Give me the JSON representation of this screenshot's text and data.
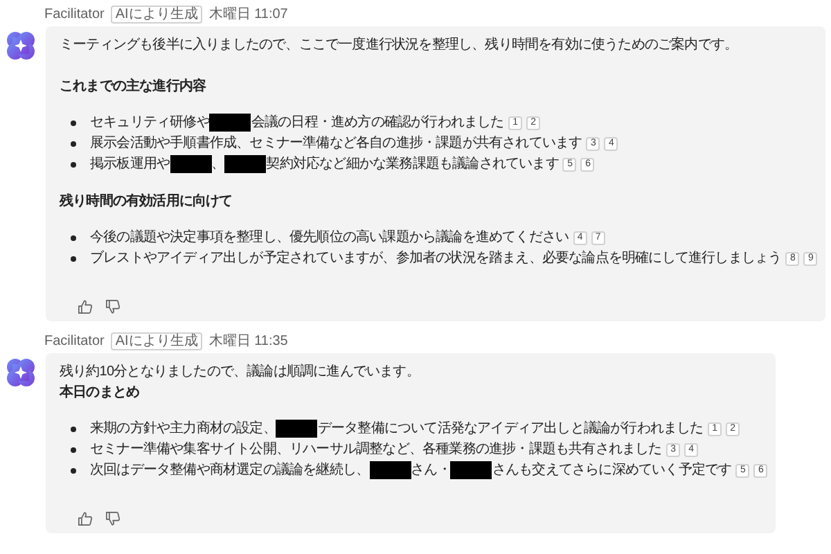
{
  "messages": [
    {
      "sender": "Facilitator",
      "badge": "AIにより生成",
      "time": "木曜日 11:07",
      "blocks": [
        {
          "kind": "paragraph",
          "text": "ミーティングも後半に入りましたので、ここで一度進行状況を整理し、残り時間を有効に使うためのご案内です。"
        },
        {
          "kind": "heading",
          "text": "これまでの主な進行内容"
        },
        {
          "kind": "list",
          "items": [
            {
              "parts": [
                {
                  "kind": "text",
                  "text": "セキュリティ研修や"
                },
                {
                  "kind": "redacted"
                },
                {
                  "kind": "text",
                  "text": "会議の日程・進め方の確認が行われました"
                }
              ],
              "citations": [
                "1",
                "2"
              ]
            },
            {
              "parts": [
                {
                  "kind": "text",
                  "text": "展示会活動や手順書作成、セミナー準備など各自の進捗・課題が共有されています"
                }
              ],
              "citations": [
                "3",
                "4"
              ]
            },
            {
              "parts": [
                {
                  "kind": "text",
                  "text": "掲示板運用や"
                },
                {
                  "kind": "redacted"
                },
                {
                  "kind": "text",
                  "text": "、"
                },
                {
                  "kind": "redacted"
                },
                {
                  "kind": "text",
                  "text": "契約対応など細かな業務課題も議論されています"
                }
              ],
              "citations": [
                "5",
                "6"
              ]
            }
          ]
        },
        {
          "kind": "heading",
          "text": "残り時間の有効活用に向けて"
        },
        {
          "kind": "list",
          "items": [
            {
              "parts": [
                {
                  "kind": "text",
                  "text": "今後の議題や決定事項を整理し、優先順位の高い課題から議論を進めてください"
                }
              ],
              "citations": [
                "4",
                "7"
              ]
            },
            {
              "parts": [
                {
                  "kind": "text",
                  "text": "ブレストやアイディア出しが予定されていますが、参加者の状況を踏まえ、必要な論点を明確にして進行しましょう"
                }
              ],
              "citations": [
                "8",
                "9"
              ]
            }
          ]
        }
      ]
    },
    {
      "sender": "Facilitator",
      "badge": "AIにより生成",
      "time": "木曜日 11:35",
      "blocks": [
        {
          "kind": "lead",
          "text": "残り約10分となりましたので、議論は順調に進んでいます。",
          "title": "本日のまとめ"
        },
        {
          "kind": "list",
          "items": [
            {
              "parts": [
                {
                  "kind": "text",
                  "text": "来期の方針や主力商材の設定、"
                },
                {
                  "kind": "redacted"
                },
                {
                  "kind": "text",
                  "text": "データ整備について活発なアイディア出しと議論が行われました"
                }
              ],
              "citations": [
                "1",
                "2"
              ]
            },
            {
              "parts": [
                {
                  "kind": "text",
                  "text": "セミナー準備や集客サイト公開、リハーサル調整など、各種業務の進捗・課題も共有されました"
                }
              ],
              "citations": [
                "3",
                "4"
              ]
            },
            {
              "parts": [
                {
                  "kind": "text",
                  "text": "次回はデータ整備や商材選定の議論を継続し、"
                },
                {
                  "kind": "redacted"
                },
                {
                  "kind": "text",
                  "text": "さん・"
                },
                {
                  "kind": "redacted"
                },
                {
                  "kind": "text",
                  "text": "さんも交えてさらに深めていく予定です"
                }
              ],
              "citations": [
                "5",
                "6"
              ]
            }
          ]
        }
      ]
    }
  ]
}
